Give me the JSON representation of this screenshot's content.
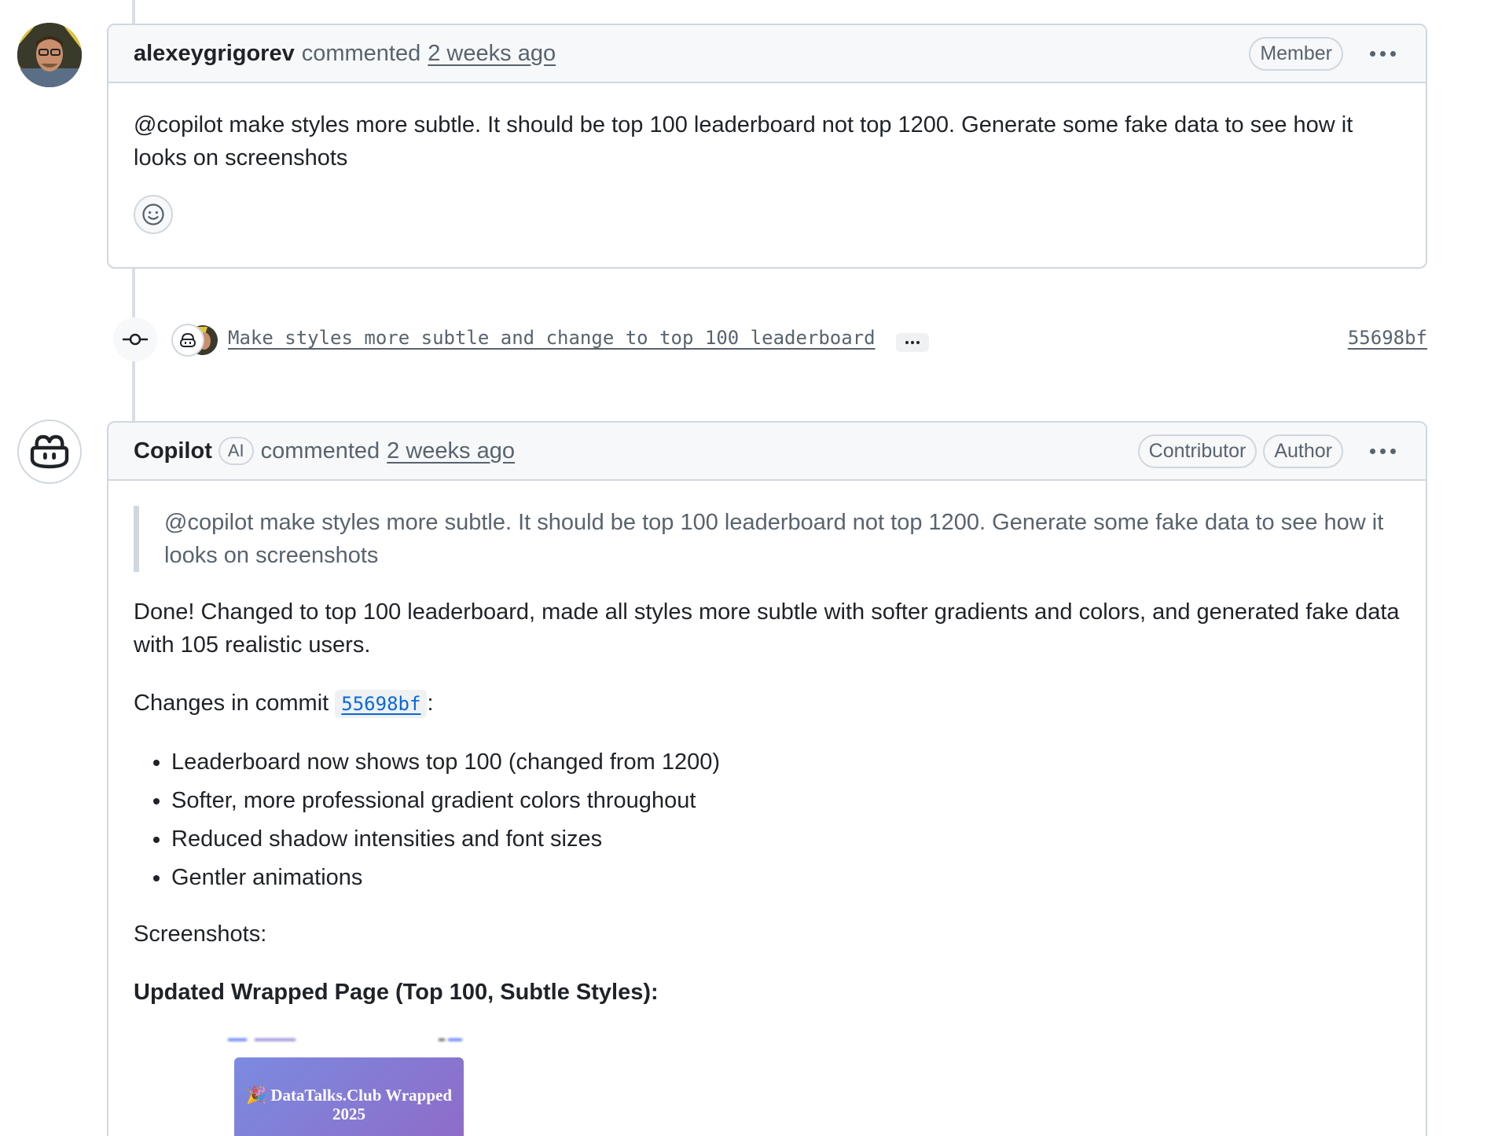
{
  "comment1": {
    "author": "alexeygrigorev",
    "action": "commented",
    "timestamp": "2 weeks ago",
    "role_label": "Member",
    "body": "@copilot make styles more subtle. It should be top 100 leaderboard not top 1200. Generate some fake data to see how it looks on screenshots"
  },
  "commit": {
    "message": "Make styles more subtle and change to top 100 leaderboard",
    "sha": "55698bf"
  },
  "comment2": {
    "author": "Copilot",
    "ai_badge": "AI",
    "action": "commented",
    "timestamp": "2 weeks ago",
    "labels": [
      "Contributor",
      "Author"
    ],
    "quote": "@copilot make styles more subtle. It should be top 100 leaderboard not top 1200. Generate some fake data to see how it looks on screenshots",
    "intro": "Done! Changed to top 100 leaderboard, made all styles more subtle with softer gradients and colors, and generated fake data with 105 realistic users.",
    "changes_prefix": "Changes in commit",
    "changes_sha": "55698bf",
    "changes_suffix": ":",
    "bullets": [
      "Leaderboard now shows top 100 (changed from 1200)",
      "Softer, more professional gradient colors throughout",
      "Reduced shadow intensities and font sizes",
      "Gentler animations"
    ],
    "screenshots_label": "Screenshots:",
    "screenshot_heading": "Updated Wrapped Page (Top 100, Subtle Styles):",
    "screenshot_banner_line1": "🎉 DataTalks.Club Wrapped",
    "screenshot_banner_line2": "2025"
  },
  "colors": {
    "border": "#d0d7de",
    "header_bg": "#f6f8fa",
    "link": "#0969da",
    "muted": "#59636e"
  }
}
